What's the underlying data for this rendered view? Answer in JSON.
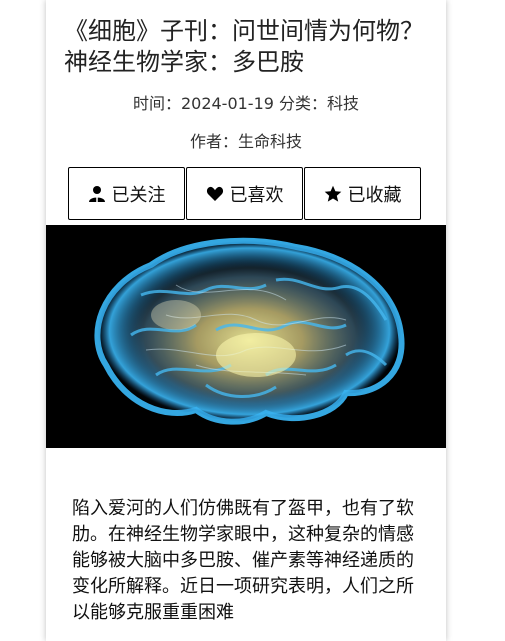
{
  "article": {
    "title": "《细胞》子刊：问世间情为何物？神经生物学家：多巴胺",
    "meta_line": "时间：2024-01-19 分类：科技",
    "author_line": "作者：生命科技",
    "actions": [
      {
        "label": "已关注",
        "icon": "user-icon"
      },
      {
        "label": "已喜欢",
        "icon": "heart-icon"
      },
      {
        "label": "已收藏",
        "icon": "star-icon"
      }
    ],
    "image_alt": "brain-illustration",
    "body": "陷入爱河的人们仿佛既有了盔甲，也有了软肋。在神经生物学家眼中，这种复杂的情感能够被大脑中多巴胺、催产素等神经递质的变化所解释。近日一项研究表明，人们之所以能够克服重重困难"
  },
  "colors": {
    "text": "#222222",
    "border": "#000000",
    "hero_bg": "#000000",
    "brain_blue": "#2fa8e8",
    "brain_glow": "#f2ef7a"
  }
}
